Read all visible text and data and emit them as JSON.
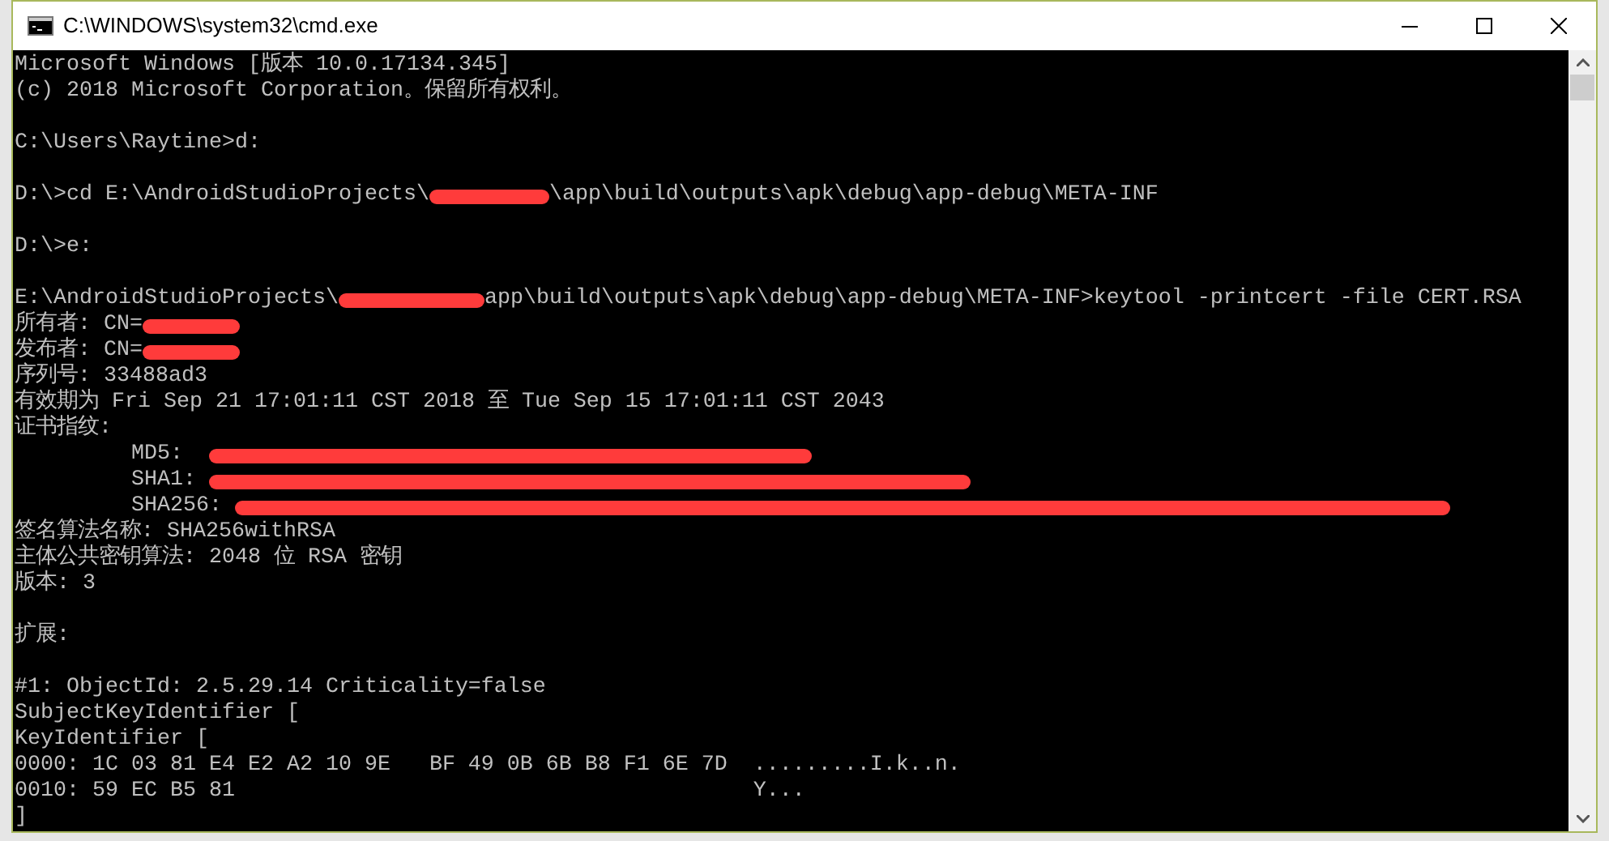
{
  "window": {
    "title": "C:\\WINDOWS\\system32\\cmd.exe"
  },
  "console": {
    "lines": [
      {
        "kind": "text",
        "segments": [
          {
            "kind": "text",
            "text": "Microsoft Windows [版本 10.0.17134.345]"
          }
        ]
      },
      {
        "kind": "text",
        "segments": [
          {
            "kind": "text",
            "text": "(c) 2018 Microsoft Corporation。保留所有权利。"
          }
        ]
      },
      {
        "kind": "blank"
      },
      {
        "kind": "text",
        "segments": [
          {
            "kind": "text",
            "text": "C:\\Users\\Raytine>d:"
          }
        ]
      },
      {
        "kind": "blank"
      },
      {
        "kind": "text",
        "segments": [
          {
            "kind": "text",
            "text": "D:\\>cd E:\\AndroidStudioProjects\\"
          },
          {
            "kind": "redaction"
          },
          {
            "kind": "text",
            "text": "\\app\\build\\outputs\\apk\\debug\\app-debug\\META-INF"
          }
        ]
      },
      {
        "kind": "blank"
      },
      {
        "kind": "text",
        "segments": [
          {
            "kind": "text",
            "text": "D:\\>e:"
          }
        ]
      },
      {
        "kind": "blank"
      },
      {
        "kind": "text",
        "segments": [
          {
            "kind": "text",
            "text": "E:\\AndroidStudioProjects\\"
          },
          {
            "kind": "redaction"
          },
          {
            "kind": "text",
            "text": "app\\build\\outputs\\apk\\debug\\app-debug\\META-INF>keytool -printcert -file CERT.RSA"
          }
        ]
      },
      {
        "kind": "text",
        "segments": [
          {
            "kind": "text",
            "text": "所有者: CN="
          },
          {
            "kind": "redaction"
          }
        ]
      },
      {
        "kind": "text",
        "segments": [
          {
            "kind": "text",
            "text": "发布者: CN="
          },
          {
            "kind": "redaction"
          }
        ]
      },
      {
        "kind": "text",
        "segments": [
          {
            "kind": "text",
            "text": "序列号: 33488ad3"
          }
        ]
      },
      {
        "kind": "text",
        "segments": [
          {
            "kind": "text",
            "text": "有效期为 Fri Sep 21 17:01:11 CST 2018 至 Tue Sep 15 17:01:11 CST 2043"
          }
        ]
      },
      {
        "kind": "text",
        "segments": [
          {
            "kind": "text",
            "text": "证书指纹:"
          }
        ]
      },
      {
        "kind": "text",
        "segments": [
          {
            "kind": "text",
            "text": "         MD5:  "
          },
          {
            "kind": "redaction"
          }
        ]
      },
      {
        "kind": "text",
        "segments": [
          {
            "kind": "text",
            "text": "         SHA1: "
          },
          {
            "kind": "redaction"
          }
        ]
      },
      {
        "kind": "text",
        "segments": [
          {
            "kind": "text",
            "text": "         SHA256: "
          },
          {
            "kind": "redaction"
          }
        ]
      },
      {
        "kind": "text",
        "segments": [
          {
            "kind": "text",
            "text": "签名算法名称: SHA256withRSA"
          }
        ]
      },
      {
        "kind": "text",
        "segments": [
          {
            "kind": "text",
            "text": "主体公共密钥算法: 2048 位 RSA 密钥"
          }
        ]
      },
      {
        "kind": "text",
        "segments": [
          {
            "kind": "text",
            "text": "版本: 3"
          }
        ]
      },
      {
        "kind": "blank"
      },
      {
        "kind": "text",
        "segments": [
          {
            "kind": "text",
            "text": "扩展:"
          }
        ]
      },
      {
        "kind": "blank"
      },
      {
        "kind": "text",
        "segments": [
          {
            "kind": "text",
            "text": "#1: ObjectId: 2.5.29.14 Criticality=false"
          }
        ]
      },
      {
        "kind": "text",
        "segments": [
          {
            "kind": "text",
            "text": "SubjectKeyIdentifier ["
          }
        ]
      },
      {
        "kind": "text",
        "segments": [
          {
            "kind": "text",
            "text": "KeyIdentifier ["
          }
        ]
      },
      {
        "kind": "text",
        "segments": [
          {
            "kind": "text",
            "text": "0000: 1C 03 81 E4 E2 A2 10 9E   BF 49 0B 6B B8 F1 6E 7D  .........I.k..n."
          }
        ]
      },
      {
        "kind": "text",
        "segments": [
          {
            "kind": "text",
            "text": "0010: 59 EC B5 81                                        Y..."
          }
        ]
      },
      {
        "kind": "text",
        "segments": [
          {
            "kind": "text",
            "text": "]"
          }
        ]
      }
    ]
  }
}
